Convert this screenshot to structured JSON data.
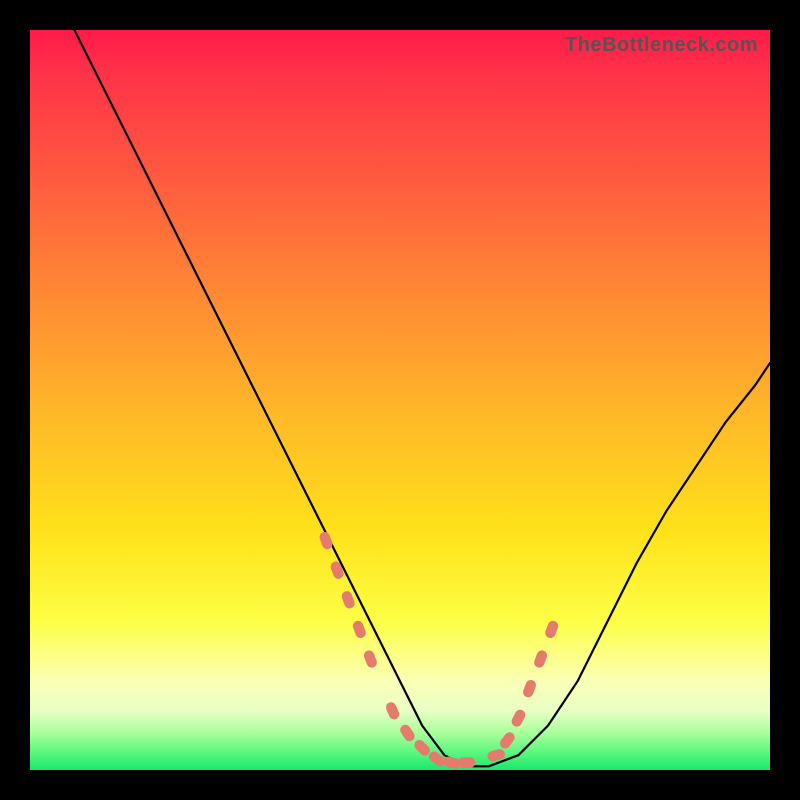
{
  "watermark": "TheBottleneck.com",
  "chart_data": {
    "type": "line",
    "title": "",
    "xlabel": "",
    "ylabel": "",
    "xlim": [
      0,
      100
    ],
    "ylim": [
      0,
      100
    ],
    "grid": false,
    "legend": false,
    "series": [
      {
        "name": "curve",
        "color": "#000000",
        "x": [
          6,
          10,
          14,
          18,
          22,
          26,
          30,
          34,
          38,
          42,
          46,
          50,
          53,
          56,
          59,
          62,
          66,
          70,
          74,
          78,
          82,
          86,
          90,
          94,
          98,
          100
        ],
        "y": [
          100,
          92,
          84,
          76,
          68,
          60,
          52,
          44,
          36,
          28,
          20,
          12,
          6,
          2,
          0.5,
          0.5,
          2,
          6,
          12,
          20,
          28,
          35,
          41,
          47,
          52,
          55
        ]
      },
      {
        "name": "highlight-dots",
        "color": "#e47b6d",
        "x": [
          40,
          41.5,
          43,
          44.5,
          46,
          49,
          51,
          53,
          55,
          57,
          59,
          63,
          64.5,
          66,
          67.5,
          69,
          70.5
        ],
        "y": [
          31,
          27,
          23,
          19,
          15,
          8,
          5,
          3,
          1.5,
          1,
          1,
          2,
          4,
          7,
          11,
          15,
          19
        ]
      }
    ]
  }
}
